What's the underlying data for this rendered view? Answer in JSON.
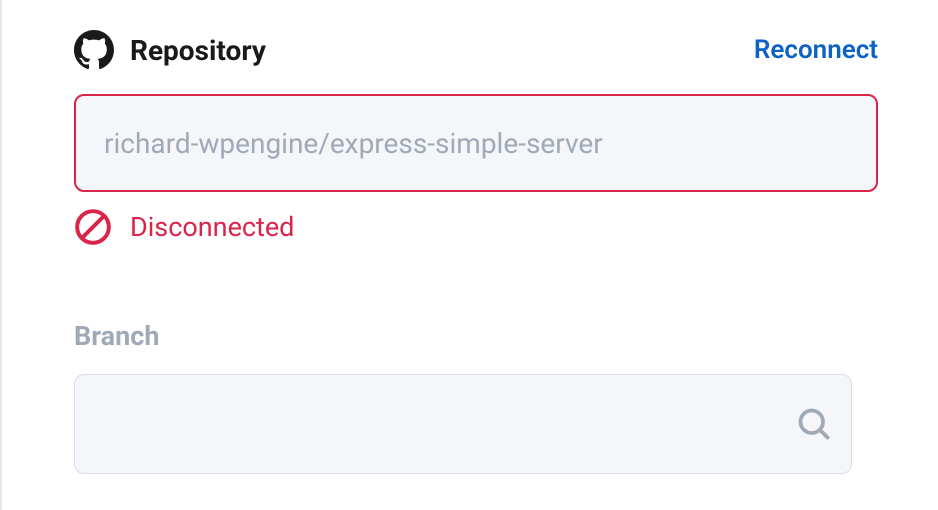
{
  "repository": {
    "label": "Repository",
    "reconnect_label": "Reconnect",
    "input_value": "richard-wpengine/express-simple-server",
    "status_text": "Disconnected"
  },
  "branch": {
    "label": "Branch",
    "input_value": ""
  }
}
